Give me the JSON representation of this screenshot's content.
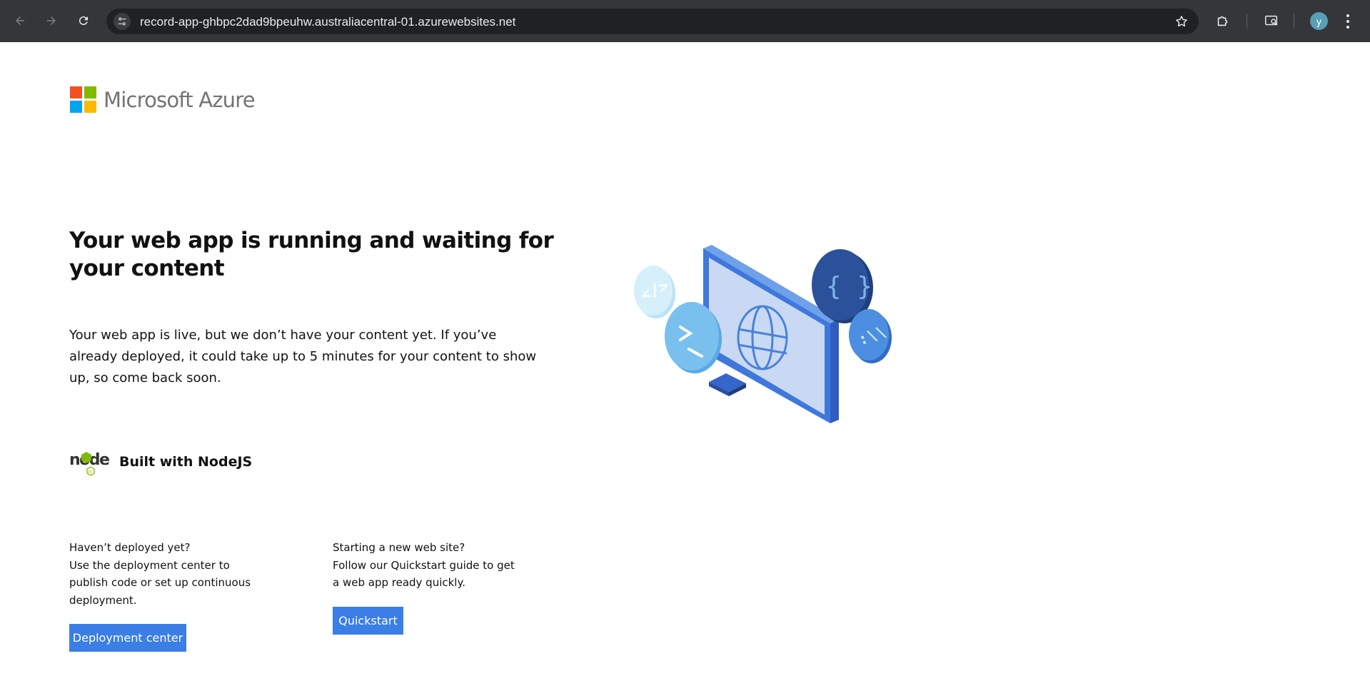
{
  "browser": {
    "url": "record-app-ghbpc2dad9bpeuhw.australiacentral-01.azurewebsites.net",
    "profile_initial": "y",
    "icons": {
      "back": "arrow-left-icon",
      "forward": "arrow-right-icon",
      "reload": "reload-icon",
      "site_info": "tune-icon",
      "bookmark": "star-icon",
      "extensions": "puzzle-icon",
      "cast": "cast-search-icon",
      "menu": "kebab-menu-icon"
    }
  },
  "brand": {
    "name": "Microsoft Azure",
    "colors": [
      "#f25022",
      "#7fba00",
      "#00a4ef",
      "#ffb900"
    ]
  },
  "hero": {
    "title": "Your web app is running and waiting for your content",
    "lead_lines": [
      "Your web app is live, but we don’t have your content yet. If you’ve",
      "already deployed, it could take up to 5 minutes for your content to show",
      "up, so come back soon."
    ]
  },
  "stack": {
    "label": "Built with NodeJS",
    "logo_text": "node",
    "logo_badge": "JS",
    "accent": "#7fba00"
  },
  "deploy": {
    "lines": [
      "Haven’t deployed yet?",
      "Use the deployment center to",
      "publish code or set up continuous",
      "deployment."
    ],
    "button": "Deployment center"
  },
  "quickstart": {
    "lines": [
      "Starting a new web site?",
      "Follow our Quickstart guide to get",
      "a web app ready quickly."
    ],
    "button": "Quickstart"
  },
  "colors": {
    "button": "#3a7ee6",
    "chrome": "#35363a",
    "omnibox": "#202124"
  }
}
